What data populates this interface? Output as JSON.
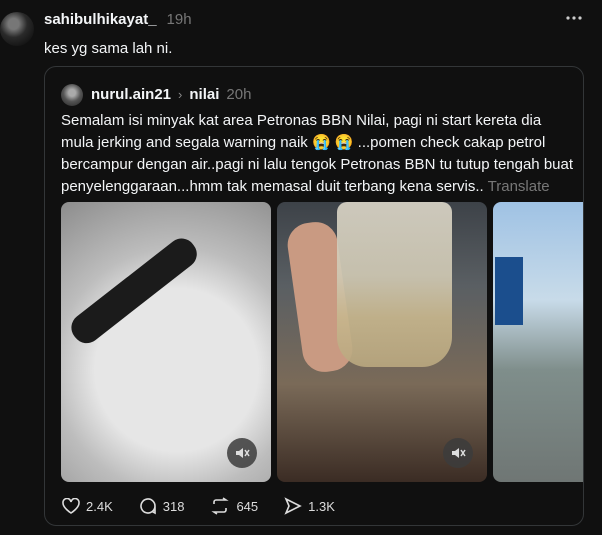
{
  "post": {
    "username": "sahibulhikayat_",
    "time": "19h",
    "text": "kes yg sama lah ni."
  },
  "quoted": {
    "username": "nurul.ain21",
    "location": "nilai",
    "time": "20h",
    "text": "Semalam isi minyak kat area Petronas BBN Nilai, pagi ni start kereta dia mula jerking and segala warning naik 😭 😭 ...pomen check cakap petrol bercampur dengan air..pagi ni lalu tengok Petronas BBN tu tutup tengah buat penyelenggaraan...hmm tak memasal duit terbang kena servis..",
    "translate_label": "Translate"
  },
  "actions": {
    "likes": "2.4K",
    "replies": "318",
    "reposts": "645",
    "shares": "1.3K"
  },
  "icons": [
    "more-icon",
    "chevron-right-icon",
    "mute-icon",
    "heart-icon",
    "comment-icon",
    "repost-icon",
    "share-icon"
  ]
}
